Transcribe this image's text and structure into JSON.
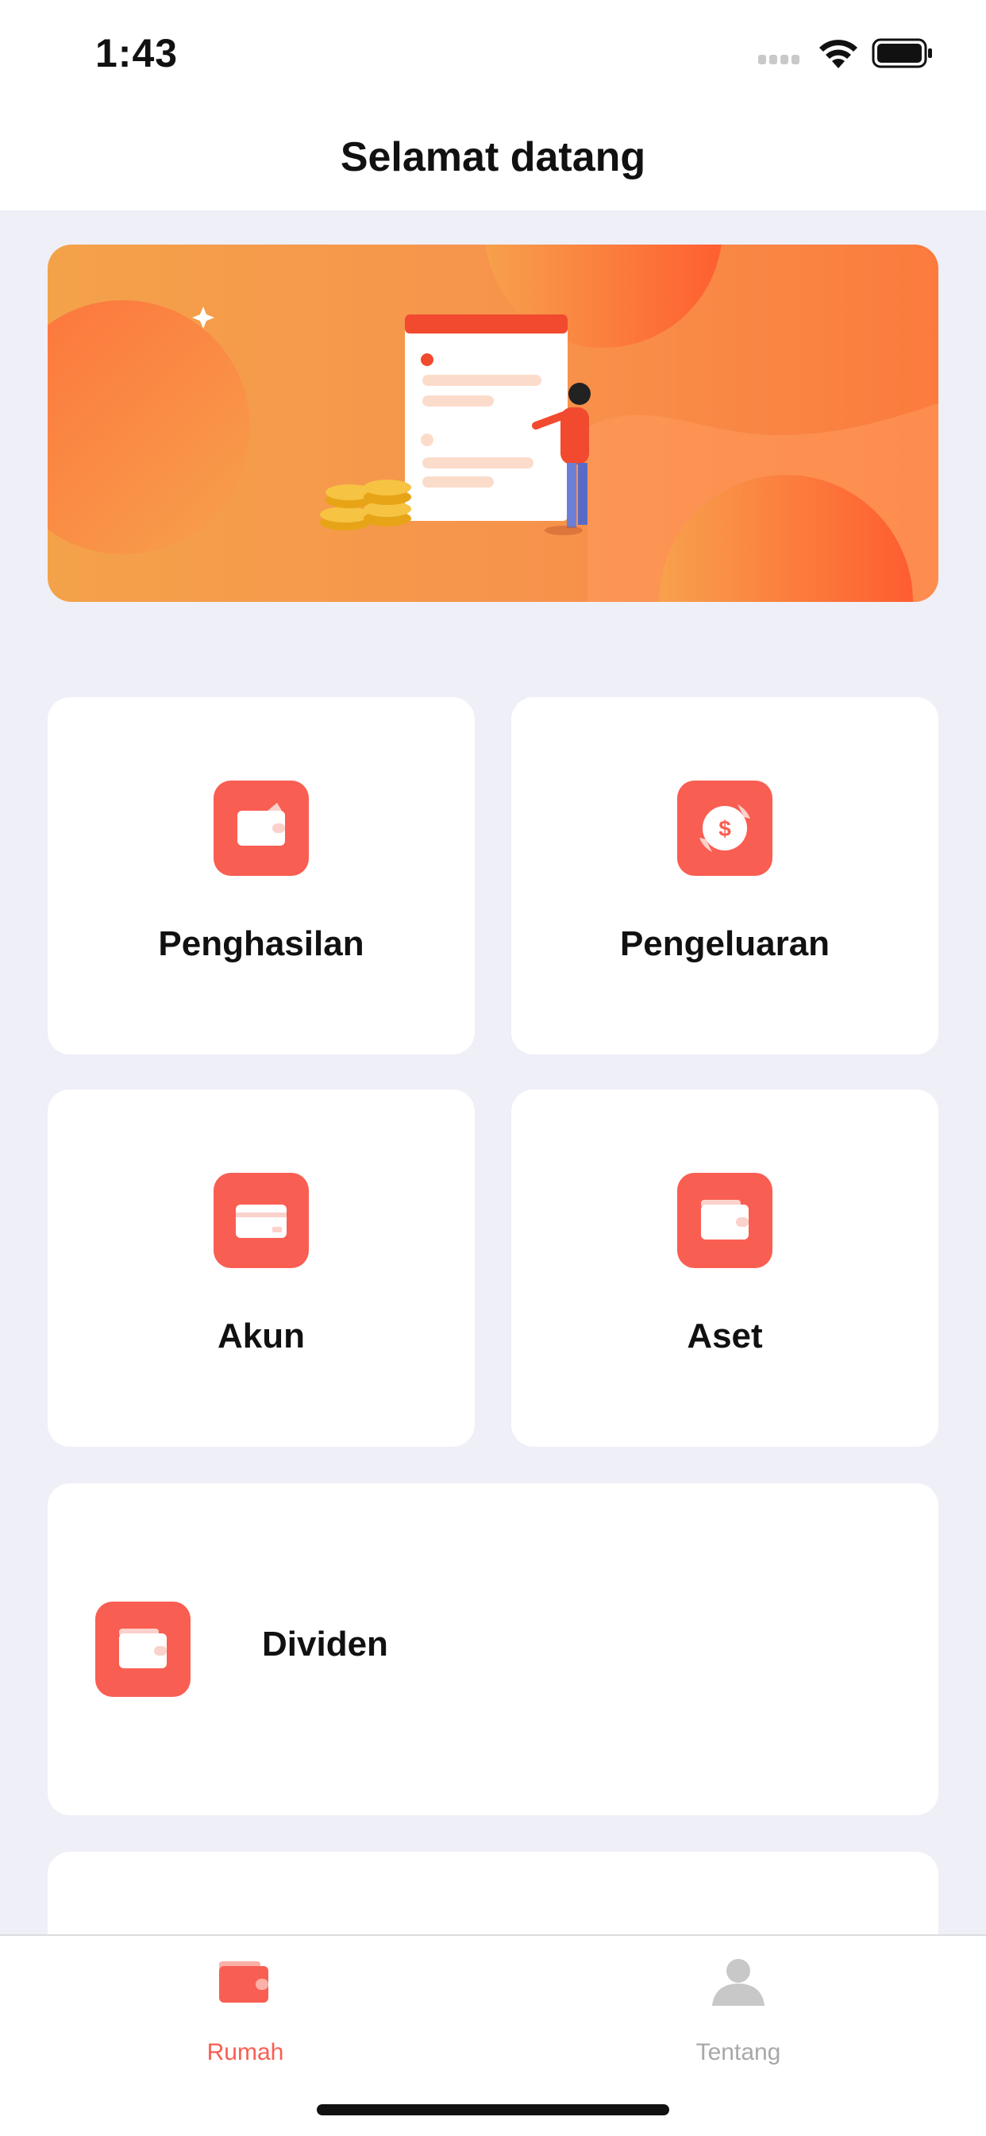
{
  "status_bar": {
    "time": "1:43"
  },
  "header": {
    "title": "Selamat datang"
  },
  "menu": {
    "income": "Penghasilan",
    "expense": "Pengeluaran",
    "account": "Akun",
    "asset": "Aset",
    "dividend": "Dividen"
  },
  "tab_bar": {
    "items": [
      {
        "label": "Rumah",
        "icon": "wallet-icon",
        "active": true
      },
      {
        "label": "Tentang",
        "icon": "person-icon",
        "active": false
      }
    ]
  },
  "colors": {
    "accent": "#F95E52",
    "tab_inactive": "#A8A8A8",
    "background": "#EFEFF7"
  }
}
